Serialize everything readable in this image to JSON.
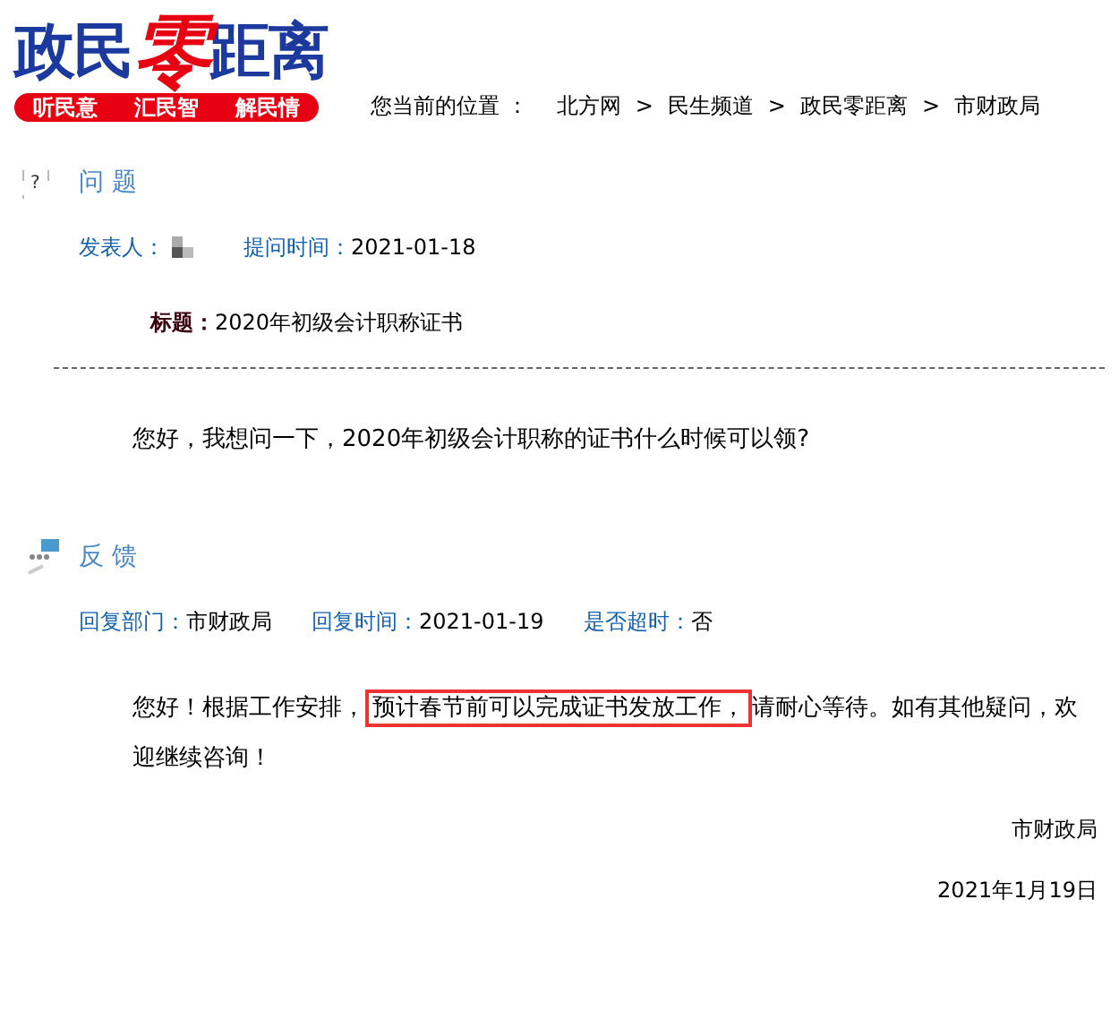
{
  "logo": {
    "parts": [
      {
        "text": "政民",
        "color": "#1c3a9e"
      },
      {
        "text": "零",
        "color": "#e60012"
      },
      {
        "text": "距离",
        "color": "#1c3a9e"
      }
    ],
    "slogans": [
      "听民意",
      "汇民智",
      "解民情"
    ]
  },
  "breadcrumb": {
    "label": "您当前的位置 ：",
    "items": [
      "北方网",
      "民生频道",
      "政民零距离",
      "市财政局"
    ],
    "separator": ">"
  },
  "question": {
    "icon_text": "?",
    "heading": "问 题",
    "poster_label": "发表人：",
    "poster_redacted": true,
    "time_label": "提问时间：",
    "time": "2021-01-18",
    "title_label": "标题：",
    "title": "2020年初级会计职称证书",
    "body": "您好，我想问一下，2020年初级会计职称的证书什么时候可以领?"
  },
  "feedback": {
    "heading": "反 馈",
    "fields": [
      {
        "label": "回复部门：",
        "value": "市财政局"
      },
      {
        "label": "回复时间：",
        "value": "2021-01-19"
      },
      {
        "label": "是否超时：",
        "value": "否"
      }
    ],
    "body": {
      "before": "您好！根据工作安排，",
      "highlighted": "预计春节前可以完成证书发放工作，",
      "after": "请耐心等待。如有其他疑问，欢迎继续咨询！"
    },
    "signature": "市财政局",
    "date": "2021年1月19日"
  }
}
